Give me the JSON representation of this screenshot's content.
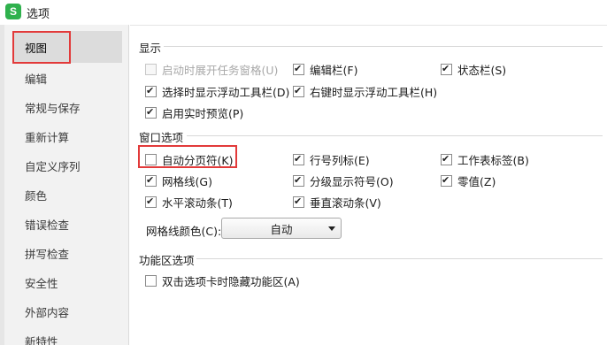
{
  "window": {
    "title": "选项",
    "app_icon_letter": "S"
  },
  "sidebar": {
    "items": [
      {
        "label": "视图",
        "active": true
      },
      {
        "label": "编辑"
      },
      {
        "label": "常规与保存"
      },
      {
        "label": "重新计算"
      },
      {
        "label": "自定义序列"
      },
      {
        "label": "颜色"
      },
      {
        "label": "错误检查"
      },
      {
        "label": "拼写检查"
      },
      {
        "label": "安全性"
      },
      {
        "label": "外部内容"
      },
      {
        "label": "新特性"
      }
    ]
  },
  "display": {
    "title": "显示",
    "options": [
      {
        "label": "启动时展开任务窗格(U)",
        "checked": false,
        "disabled": true
      },
      {
        "label": "编辑栏(F)",
        "checked": true
      },
      {
        "label": "状态栏(S)",
        "checked": true
      },
      {
        "label": "选择时显示浮动工具栏(D)",
        "checked": true
      },
      {
        "label": "右键时显示浮动工具栏(H)",
        "checked": true
      },
      {
        "label": "启用实时预览(P)",
        "checked": true
      }
    ]
  },
  "window_options": {
    "title": "窗口选项",
    "options": [
      {
        "label": "自动分页符(K)",
        "checked": false
      },
      {
        "label": "行号列标(E)",
        "checked": true
      },
      {
        "label": "工作表标签(B)",
        "checked": true
      },
      {
        "label": "网格线(G)",
        "checked": true
      },
      {
        "label": "分级显示符号(O)",
        "checked": true
      },
      {
        "label": "零值(Z)",
        "checked": true
      },
      {
        "label": "水平滚动条(T)",
        "checked": true
      },
      {
        "label": "垂直滚动条(V)",
        "checked": true
      }
    ],
    "gridline_color_label": "网格线颜色(C):",
    "gridline_color_value": "自动"
  },
  "ribbon": {
    "title": "功能区选项",
    "options": [
      {
        "label": "双击选项卡时隐藏功能区(A)",
        "checked": false
      }
    ]
  },
  "colors": {
    "highlight": "#e23a3a",
    "app_icon": "#2fb14d"
  }
}
